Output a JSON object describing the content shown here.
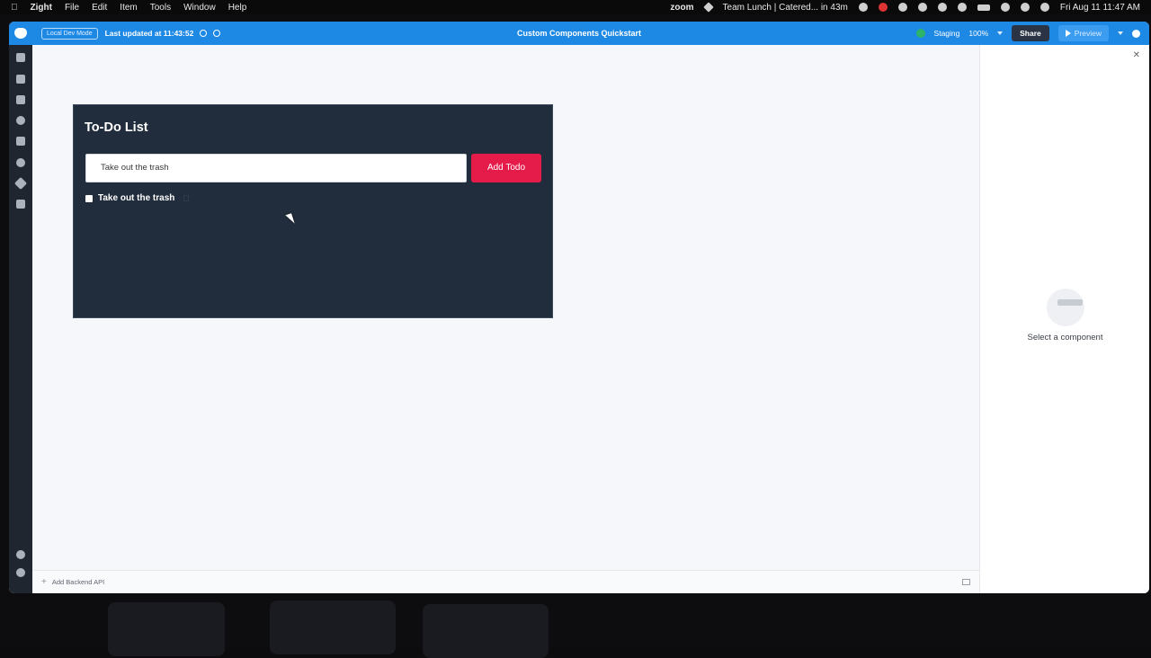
{
  "menubar": {
    "app_name": "Zight",
    "menus": [
      "File",
      "Edit",
      "Item",
      "Tools",
      "Window",
      "Help"
    ],
    "zoom_label": "zoom",
    "meeting": "Team Lunch | Catered... in 43m",
    "datetime": "Fri Aug 11  11:47 AM"
  },
  "topbar": {
    "mode_badge": "Local Dev Mode",
    "last_updated": "Last updated at 11:43:52",
    "app_title": "Custom Components Quickstart",
    "environment": "Staging",
    "zoom": "100%",
    "share_label": "Share",
    "preview_label": "Preview",
    "accent": "#1e88e5"
  },
  "todo": {
    "title": "To-Do List",
    "input_value": "Take out the trash",
    "add_button": "Add Todo",
    "items": [
      {
        "label": "Take out the trash",
        "checked": false
      }
    ]
  },
  "bottombar": {
    "add_api": "Add Backend API"
  },
  "inspector": {
    "empty_text": "Select a component"
  }
}
